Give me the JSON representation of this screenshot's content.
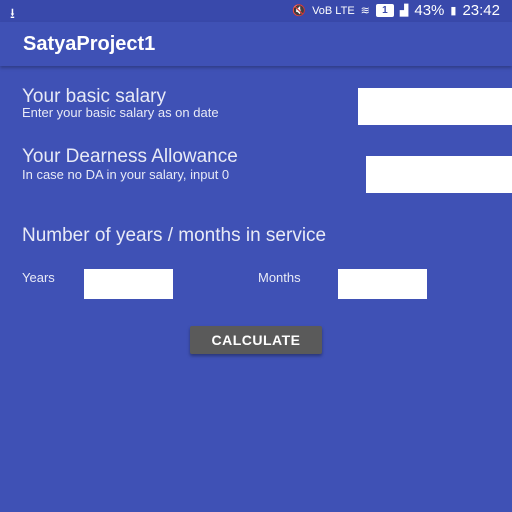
{
  "status_bar": {
    "download_icon": "download-icon",
    "signal_text": "VoB LTE",
    "sim_badge": "1",
    "battery": "43%",
    "time": "23:42"
  },
  "toolbar": {
    "title": "SatyaProject1"
  },
  "form": {
    "salary_title": "Your basic salary",
    "salary_hint": "Enter your basic salary as on date",
    "da_title": "Your Dearness Allowance",
    "da_hint": "In case no DA in your salary, input 0",
    "service_title": "Number of years / months in service",
    "years_label": "Years",
    "months_label": "Months",
    "calculate_label": "CALCULATE"
  },
  "colors": {
    "background": "#3f51b5",
    "status_bar": "#3949ab",
    "button": "#5a5a5a"
  }
}
